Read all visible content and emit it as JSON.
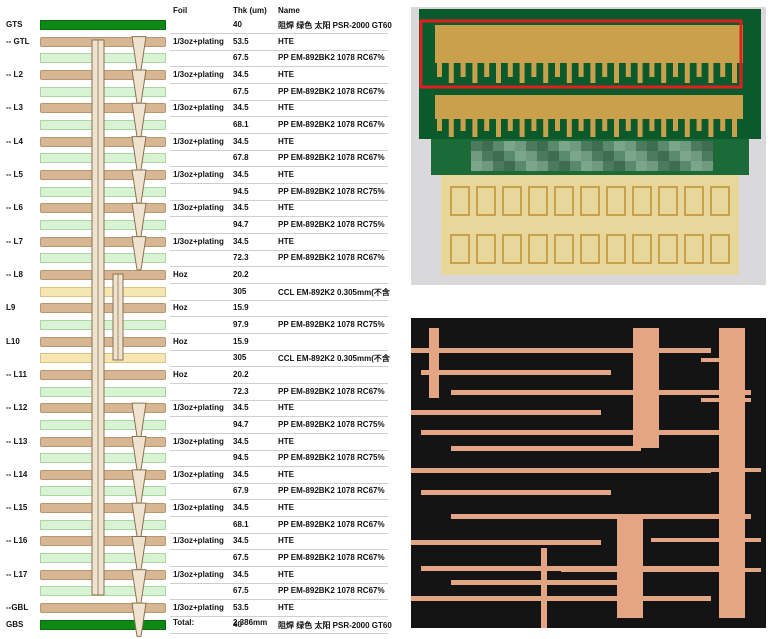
{
  "headers": {
    "foil": "Foil",
    "thk": "Thk (um)",
    "name": "Name"
  },
  "rows": [
    {
      "label": "GTS",
      "type": "mask",
      "foil": "",
      "thk": "40",
      "name": "阻焊 绿色 太阳 PSR-2000 GT60"
    },
    {
      "label": "-- GTL",
      "type": "cu",
      "foil": "1/3oz+plating",
      "thk": "53.5",
      "name": "HTE"
    },
    {
      "label": "",
      "type": "pp",
      "foil": "",
      "thk": "67.5",
      "name": "PP EM-892BK2 1078 RC67%"
    },
    {
      "label": "-- L2",
      "type": "cu",
      "foil": "1/3oz+plating",
      "thk": "34.5",
      "name": "HTE"
    },
    {
      "label": "",
      "type": "pp",
      "foil": "",
      "thk": "67.5",
      "name": "PP EM-892BK2 1078 RC67%"
    },
    {
      "label": "-- L3",
      "type": "cu",
      "foil": "1/3oz+plating",
      "thk": "34.5",
      "name": "HTE"
    },
    {
      "label": "",
      "type": "pp",
      "foil": "",
      "thk": "68.1",
      "name": "PP EM-892BK2 1078 RC67%"
    },
    {
      "label": "-- L4",
      "type": "cu",
      "foil": "1/3oz+plating",
      "thk": "34.5",
      "name": "HTE"
    },
    {
      "label": "",
      "type": "pp",
      "foil": "",
      "thk": "67.8",
      "name": "PP EM-892BK2 1078 RC67%"
    },
    {
      "label": "-- L5",
      "type": "cu",
      "foil": "1/3oz+plating",
      "thk": "34.5",
      "name": "HTE"
    },
    {
      "label": "",
      "type": "pp",
      "foil": "",
      "thk": "94.5",
      "name": "PP EM-892BK2 1078 RC75%"
    },
    {
      "label": "-- L6",
      "type": "cu",
      "foil": "1/3oz+plating",
      "thk": "34.5",
      "name": "HTE"
    },
    {
      "label": "",
      "type": "pp",
      "foil": "",
      "thk": "94.7",
      "name": "PP EM-892BK2 1078 RC75%"
    },
    {
      "label": "-- L7",
      "type": "cu",
      "foil": "1/3oz+plating",
      "thk": "34.5",
      "name": "HTE"
    },
    {
      "label": "",
      "type": "pp",
      "foil": "",
      "thk": "72.3",
      "name": "PP EM-892BK2 1078 RC67%"
    },
    {
      "label": "-- L8",
      "type": "cu",
      "foil": "Hoz",
      "thk": "20.2",
      "name": ""
    },
    {
      "label": "",
      "type": "core",
      "foil": "",
      "thk": "305",
      "name": "CCL EM-892K2 0.305mm(不含"
    },
    {
      "label": "L9",
      "type": "cu",
      "foil": "Hoz",
      "thk": "15.9",
      "name": ""
    },
    {
      "label": "",
      "type": "pp",
      "foil": "",
      "thk": "97.9",
      "name": "PP EM-892BK2 1078 RC75%"
    },
    {
      "label": "L10",
      "type": "cu",
      "foil": "Hoz",
      "thk": "15.9",
      "name": ""
    },
    {
      "label": "",
      "type": "core",
      "foil": "",
      "thk": "305",
      "name": "CCL EM-892K2 0.305mm(不含"
    },
    {
      "label": "-- L11",
      "type": "cu",
      "foil": "Hoz",
      "thk": "20.2",
      "name": ""
    },
    {
      "label": "",
      "type": "pp",
      "foil": "",
      "thk": "72.3",
      "name": "PP EM-892BK2 1078 RC67%"
    },
    {
      "label": "-- L12",
      "type": "cu",
      "foil": "1/3oz+plating",
      "thk": "34.5",
      "name": "HTE"
    },
    {
      "label": "",
      "type": "pp",
      "foil": "",
      "thk": "94.7",
      "name": "PP EM-892BK2 1078 RC75%"
    },
    {
      "label": "-- L13",
      "type": "cu",
      "foil": "1/3oz+plating",
      "thk": "34.5",
      "name": "HTE"
    },
    {
      "label": "",
      "type": "pp",
      "foil": "",
      "thk": "94.5",
      "name": "PP EM-892BK2 1078 RC75%"
    },
    {
      "label": "-- L14",
      "type": "cu",
      "foil": "1/3oz+plating",
      "thk": "34.5",
      "name": "HTE"
    },
    {
      "label": "",
      "type": "pp",
      "foil": "",
      "thk": "67.9",
      "name": "PP EM-892BK2 1078 RC67%"
    },
    {
      "label": "-- L15",
      "type": "cu",
      "foil": "1/3oz+plating",
      "thk": "34.5",
      "name": "HTE"
    },
    {
      "label": "",
      "type": "pp",
      "foil": "",
      "thk": "68.1",
      "name": "PP EM-892BK2 1078 RC67%"
    },
    {
      "label": "-- L16",
      "type": "cu",
      "foil": "1/3oz+plating",
      "thk": "34.5",
      "name": "HTE"
    },
    {
      "label": "",
      "type": "pp",
      "foil": "",
      "thk": "67.5",
      "name": "PP EM-892BK2 1078 RC67%"
    },
    {
      "label": "-- L17",
      "type": "cu",
      "foil": "1/3oz+plating",
      "thk": "34.5",
      "name": "HTE"
    },
    {
      "label": "",
      "type": "pp",
      "foil": "",
      "thk": "67.5",
      "name": "PP EM-892BK2 1078 RC67%"
    },
    {
      "label": "--GBL",
      "type": "cu",
      "foil": "1/3oz+plating",
      "thk": "53.5",
      "name": "HTE"
    },
    {
      "label": "GBS",
      "type": "mask",
      "foil": "",
      "thk": "40",
      "name": "阻焊 绿色 太阳 PSR-2000 GT60"
    }
  ],
  "total": {
    "label": "Total:",
    "value": "2.386mm"
  },
  "colors": {
    "copper": "#d7b793",
    "prepreg": "#d8f3d4",
    "core": "#f5e6b2",
    "soldermask": "#0e8a14",
    "highlight": "#e02020"
  }
}
